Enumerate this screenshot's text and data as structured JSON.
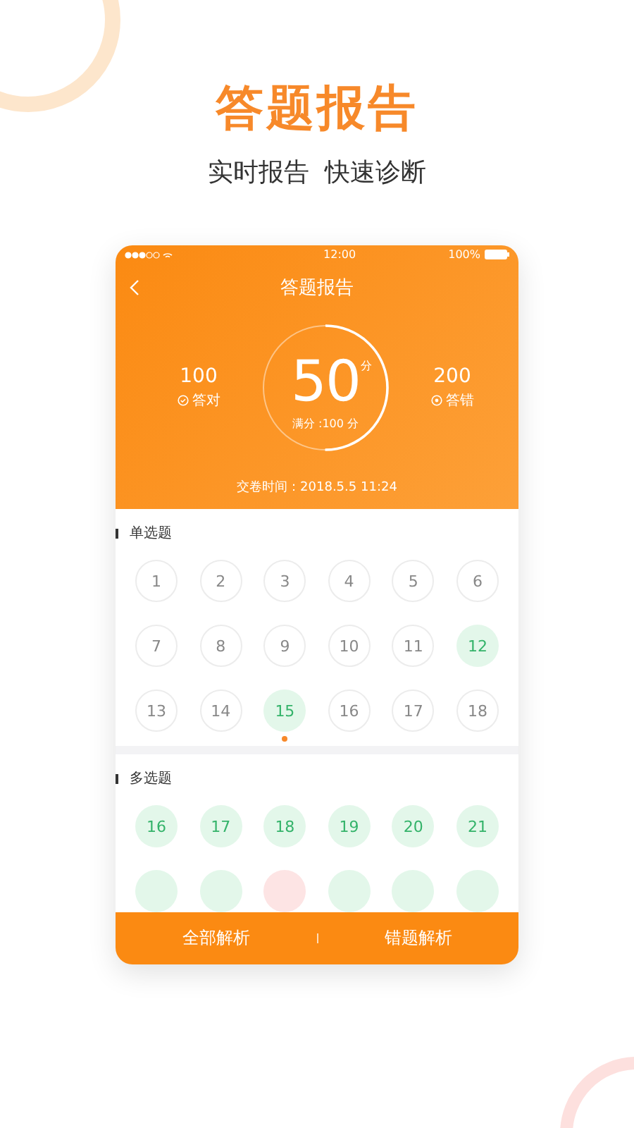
{
  "headline": "答题报告",
  "subtitle": "实时报告  快速诊断",
  "status_bar": {
    "time": "12:00",
    "battery": "100%"
  },
  "nav": {
    "title": "答题报告"
  },
  "score": {
    "value": "50",
    "unit": "分",
    "full": "满分 :100 分",
    "level": 0.5,
    "correct": {
      "count": "100",
      "label": "答对"
    },
    "wrong": {
      "count": "200",
      "label": "答错"
    },
    "submitted": "交卷时间：2018.5.5  11:24"
  },
  "sections": [
    {
      "title": "单选题",
      "questions": [
        {
          "label": "1",
          "kind": "neutral",
          "current": false
        },
        {
          "label": "2",
          "kind": "neutral",
          "current": false
        },
        {
          "label": "3",
          "kind": "neutral",
          "current": false
        },
        {
          "label": "4",
          "kind": "neutral",
          "current": false
        },
        {
          "label": "5",
          "kind": "neutral",
          "current": false
        },
        {
          "label": "6",
          "kind": "neutral",
          "current": false
        },
        {
          "label": "7",
          "kind": "neutral",
          "current": false
        },
        {
          "label": "8",
          "kind": "neutral",
          "current": false
        },
        {
          "label": "9",
          "kind": "neutral",
          "current": false
        },
        {
          "label": "10",
          "kind": "neutral",
          "current": false
        },
        {
          "label": "11",
          "kind": "neutral",
          "current": false
        },
        {
          "label": "12",
          "kind": "correct",
          "current": false
        },
        {
          "label": "13",
          "kind": "neutral",
          "current": false
        },
        {
          "label": "14",
          "kind": "neutral",
          "current": false
        },
        {
          "label": "15",
          "kind": "correct",
          "current": true
        },
        {
          "label": "16",
          "kind": "neutral",
          "current": false
        },
        {
          "label": "17",
          "kind": "neutral",
          "current": false
        },
        {
          "label": "18",
          "kind": "neutral",
          "current": false
        }
      ]
    },
    {
      "title": "多选题",
      "questions": [
        {
          "label": "16",
          "kind": "correct",
          "current": false
        },
        {
          "label": "17",
          "kind": "correct",
          "current": false
        },
        {
          "label": "18",
          "kind": "correct",
          "current": false
        },
        {
          "label": "19",
          "kind": "correct",
          "current": false
        },
        {
          "label": "20",
          "kind": "correct",
          "current": false
        },
        {
          "label": "21",
          "kind": "correct",
          "current": false
        },
        {
          "kind": "correct",
          "current": false
        },
        {
          "kind": "correct",
          "current": false
        },
        {
          "kind": "wrong",
          "current": false
        },
        {
          "kind": "correct",
          "current": false
        },
        {
          "kind": "correct",
          "current": false
        },
        {
          "kind": "correct",
          "current": false
        }
      ]
    }
  ],
  "bottom_bar": [
    "全部解析",
    "错题解析"
  ]
}
